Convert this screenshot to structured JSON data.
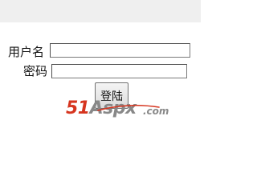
{
  "form": {
    "username_label": "用户名",
    "username_value": "",
    "password_label": "密码",
    "password_value": "",
    "login_label": "登陆"
  },
  "watermark": {
    "brand_digits": "51",
    "brand_name": "Aspx",
    "tld": ".com",
    "colors": {
      "red": "#d6351f",
      "gray": "#888888"
    }
  }
}
